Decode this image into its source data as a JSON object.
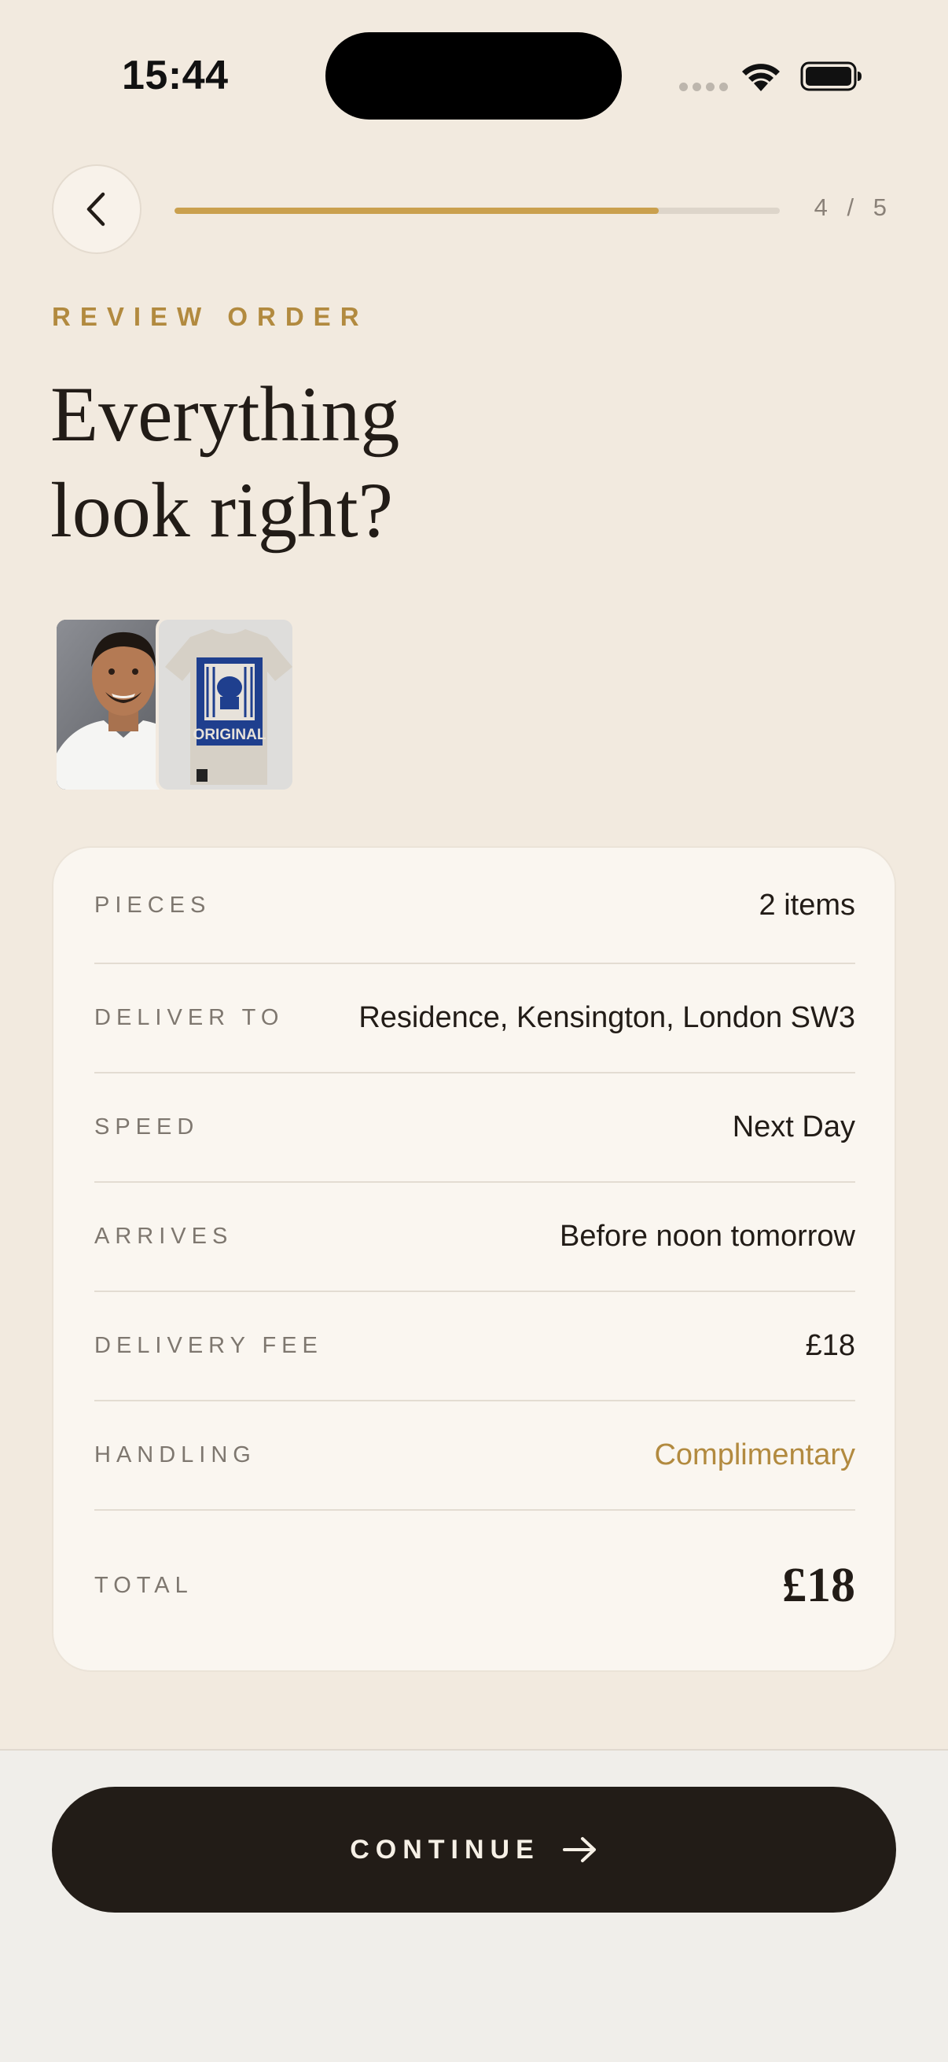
{
  "status_bar": {
    "time": "15:44"
  },
  "header": {
    "step_counter": "4 / 5",
    "progress_fraction": 0.8
  },
  "eyebrow": "REVIEW ORDER",
  "title_line1": "Everything",
  "title_line2": "look right?",
  "thumbnails": [
    {
      "icon": "person-photo"
    },
    {
      "icon": "tshirt-photo",
      "print_text": "ORIGINAL"
    }
  ],
  "summary": [
    {
      "label": "PIECES",
      "value": "2 items"
    },
    {
      "label": "DELIVER TO",
      "value": "Residence, Kensington, London SW3"
    },
    {
      "label": "SPEED",
      "value": "Next Day"
    },
    {
      "label": "ARRIVES",
      "value": "Before noon tomorrow"
    },
    {
      "label": "DELIVERY FEE",
      "value": "£18"
    },
    {
      "label": "HANDLING",
      "value": "Complimentary"
    },
    {
      "label": "TOTAL",
      "value": "£18"
    }
  ],
  "footer": {
    "continue_label": "CONTINUE"
  },
  "colors": {
    "background": "#f2eadf",
    "accent": "#b28a3f",
    "progress": "#caa04e",
    "dark": "#221c17"
  }
}
